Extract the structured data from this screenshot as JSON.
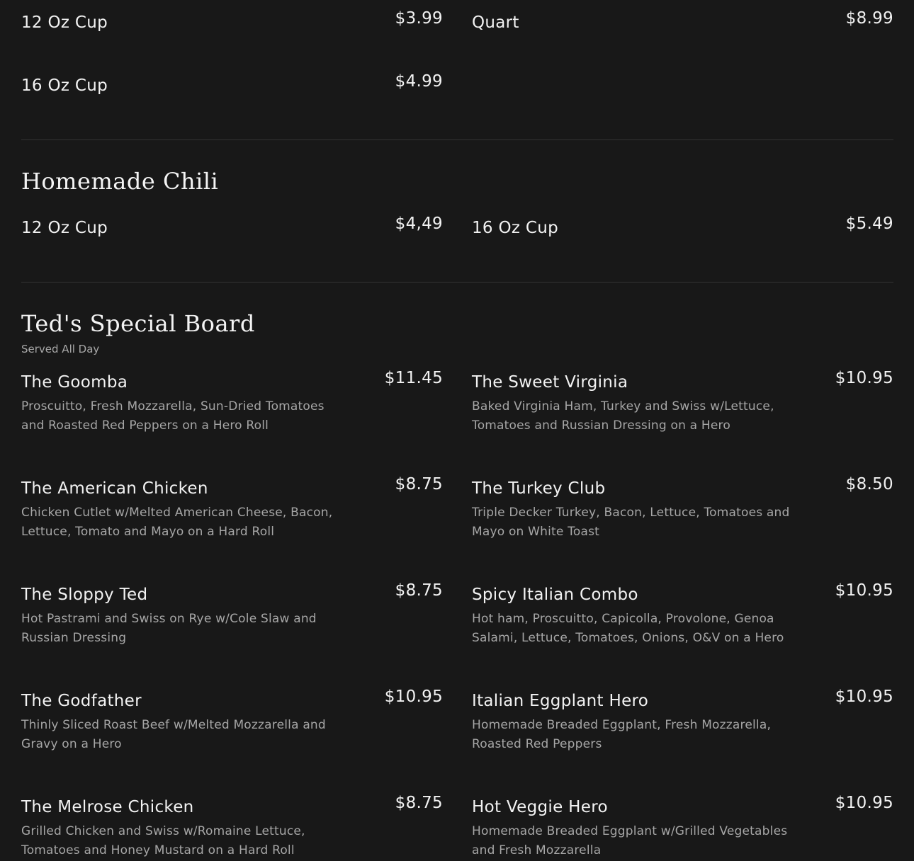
{
  "soup_section": {
    "items": [
      {
        "name": "12 Oz Cup",
        "price": "$3.99"
      },
      {
        "name": "Quart",
        "price": "$8.99"
      },
      {
        "name": "16 Oz Cup",
        "price": "$4.99"
      }
    ]
  },
  "chili_section": {
    "title": "Homemade Chili",
    "items": [
      {
        "name": "12 Oz Cup",
        "price": "$4,49"
      },
      {
        "name": "16 Oz Cup",
        "price": "$5.49"
      }
    ]
  },
  "board_section": {
    "title": "Ted's Special Board",
    "subtitle": "Served All Day",
    "items": [
      {
        "name": "The Goomba",
        "price": "$11.45",
        "desc": "Proscuitto, Fresh Mozzarella, Sun-Dried Tomatoes and Roasted Red Peppers on a Hero Roll"
      },
      {
        "name": "The Sweet Virginia",
        "price": "$10.95",
        "desc": "Baked Virginia Ham, Turkey and Swiss w/Lettuce, Tomatoes and Russian Dressing on a Hero"
      },
      {
        "name": "The American Chicken",
        "price": "$8.75",
        "desc": "Chicken Cutlet w/Melted American Cheese, Bacon, Lettuce, Tomato and Mayo on a Hard Roll"
      },
      {
        "name": "The Turkey Club",
        "price": "$8.50",
        "desc": "Triple Decker Turkey, Bacon, Lettuce, Tomatoes and Mayo on White Toast"
      },
      {
        "name": "The Sloppy Ted",
        "price": "$8.75",
        "desc": "Hot Pastrami and Swiss on Rye w/Cole Slaw and Russian Dressing"
      },
      {
        "name": "Spicy Italian Combo",
        "price": "$10.95",
        "desc": "Hot ham, Proscuitto, Capicolla, Provolone, Genoa Salami, Lettuce, Tomatoes, Onions, O&V on a Hero"
      },
      {
        "name": "The Godfather",
        "price": "$10.95",
        "desc": "Thinly Sliced Roast Beef w/Melted Mozzarella and Gravy on a Hero"
      },
      {
        "name": "Italian Eggplant Hero",
        "price": "$10.95",
        "desc": "Homemade Breaded Eggplant, Fresh Mozzarella, Roasted Red Peppers"
      },
      {
        "name": "The Melrose Chicken",
        "price": "$8.75",
        "desc": "Grilled Chicken and Swiss w/Romaine Lettuce, Tomatoes and Honey Mustard on a Hard Roll"
      },
      {
        "name": "Hot Veggie Hero",
        "price": "$10.95",
        "desc": "Homemade Breaded Eggplant w/Grilled Vegetables and Fresh Mozzarella"
      }
    ]
  }
}
